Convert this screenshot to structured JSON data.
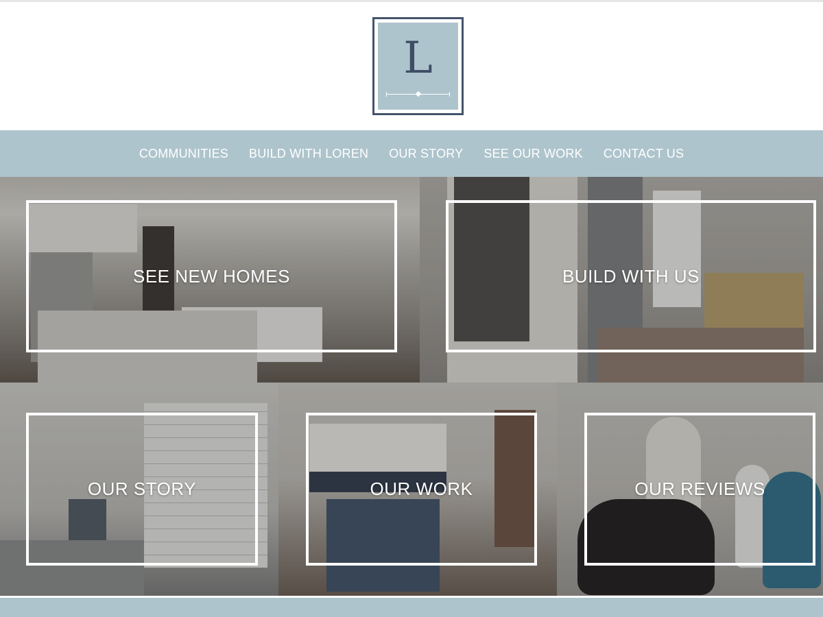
{
  "logo": {
    "letter": "L",
    "icon": "brand-monogram-logo",
    "colors": {
      "border": "#44536a",
      "fill": "#aec4cd"
    }
  },
  "nav": {
    "background": "#aec4cc",
    "items": [
      {
        "label": "COMMUNITIES"
      },
      {
        "label": "BUILD WITH LOREN"
      },
      {
        "label": "OUR STORY"
      },
      {
        "label": "SEE OUR WORK"
      },
      {
        "label": "CONTACT US"
      }
    ]
  },
  "tiles": [
    {
      "label": "SEE NEW HOMES",
      "photo": "kitchen-interior"
    },
    {
      "label": "BUILD WITH US",
      "photo": "front-porch-door"
    },
    {
      "label": "OUR STORY",
      "photo": "bathroom-shower"
    },
    {
      "label": "OUR WORK",
      "photo": "kitchen-island-pantry"
    },
    {
      "label": "OUR REVIEWS",
      "photo": "family-with-dog"
    }
  ]
}
